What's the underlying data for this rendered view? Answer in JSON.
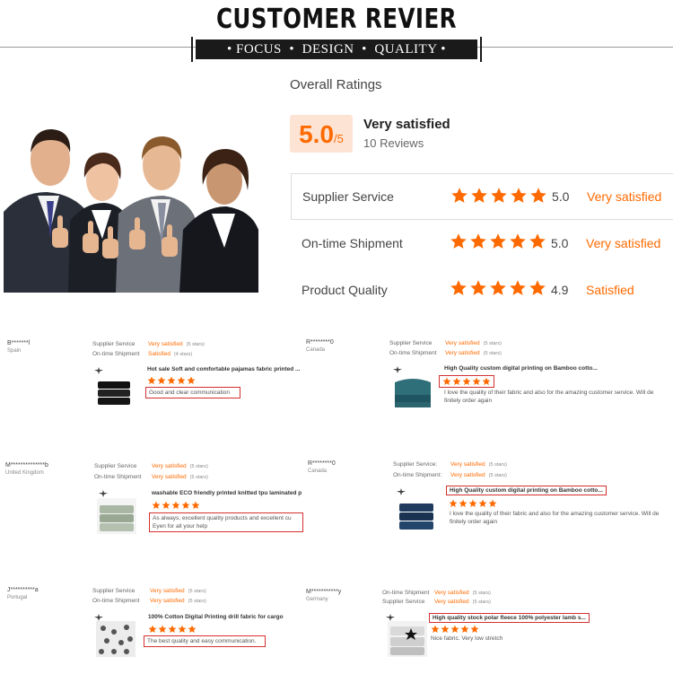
{
  "header": {
    "title": "CUSTOMER REVIER",
    "tagline": "• FOCUS  •  DESIGN  •  QUALITY •"
  },
  "overall": {
    "section_title": "Overall Ratings",
    "score": "5.0",
    "score_max": "/5",
    "label": "Very satisfied",
    "review_count": "10 Reviews",
    "rows": [
      {
        "label": "Supplier Service",
        "value": "5.0",
        "text": "Very satisfied",
        "stars": 5
      },
      {
        "label": "On-time Shipment",
        "value": "5.0",
        "text": "Very satisfied",
        "stars": 5
      },
      {
        "label": "Product Quality",
        "value": "4.9",
        "text": "Satisfied",
        "stars": 5
      }
    ]
  },
  "colors": {
    "accent": "#ff6a00",
    "score_bg": "#fde3d4",
    "highlight_border": "#d43030"
  },
  "reviews": [
    {
      "user": "B*******l",
      "country": "Spain",
      "line1_label": "Supplier Service",
      "line1_value": "Very satisfied",
      "line1_stars": "(5 stars)",
      "line2_label": "On-time Shipment",
      "line2_value": "Satisfied",
      "line2_stars": "(4 stars)",
      "product": "Hot sale Soft and comfortable pajamas fabric printed ...",
      "comment": "Good and clear communication"
    },
    {
      "user": "R********0",
      "country": "Canada",
      "line1_label": "Supplier Service",
      "line1_value": "Very satisfied",
      "line1_stars": "(5 stars)",
      "line2_label": "On-time Shipment",
      "line2_value": "Very satisfied",
      "line2_stars": "(5 stars)",
      "product": "High Quality custom digital printing on Bamboo cotto...",
      "comment": "I love the quality of their fabric and also for the amazing customer service. Will de finitely order again"
    },
    {
      "user": "M**************b",
      "country": "United Kingdom",
      "line1_label": "Supplier Service",
      "line1_value": "Very satisfied",
      "line1_stars": "(5 stars)",
      "line2_label": "On-time Shipment",
      "line2_value": "Very satisfied",
      "line2_stars": "(5 stars)",
      "product": "washable ECO friendly printed knitted tpu laminated p",
      "comment": "As always, excellent quality products and excellent cu Eyen for all your help"
    },
    {
      "user": "R********0",
      "country": "Canada",
      "line1_label": "Supplier Service:",
      "line1_value": "Very satisfied",
      "line1_stars": "(5 stars)",
      "line2_label": "On-time Shipment:",
      "line2_value": "Very satisfied",
      "line2_stars": "(5 stars)",
      "product": "High Quality custom digital printing on Bamboo cotto...",
      "comment": "I love the quality of their fabric and also for the amazing customer service. Will de finitely order again"
    },
    {
      "user": "J**********a",
      "country": "Portugal",
      "line1_label": "Supplier Service",
      "line1_value": "Very satisfied",
      "line1_stars": "(5 stars)",
      "line2_label": "On-time Shipment",
      "line2_value": "Very satisfied",
      "line2_stars": "(5 stars)",
      "product": "100% Cotton Digital Printing drill fabric for cargo",
      "comment": "The best quality and easy communication."
    },
    {
      "user": "M***********y",
      "country": "Germany",
      "line1_label": "On-time Shipment",
      "line1_value": "Very satisfied",
      "line1_stars": "(5 stars)",
      "line2_label": "Supplier Service",
      "line2_value": "Very satisfied",
      "line2_stars": "(5 stars)",
      "product": "High quality stock polar fleece 100% polyester lamb s...",
      "comment": "Nice fabric. Very low stretch"
    }
  ]
}
